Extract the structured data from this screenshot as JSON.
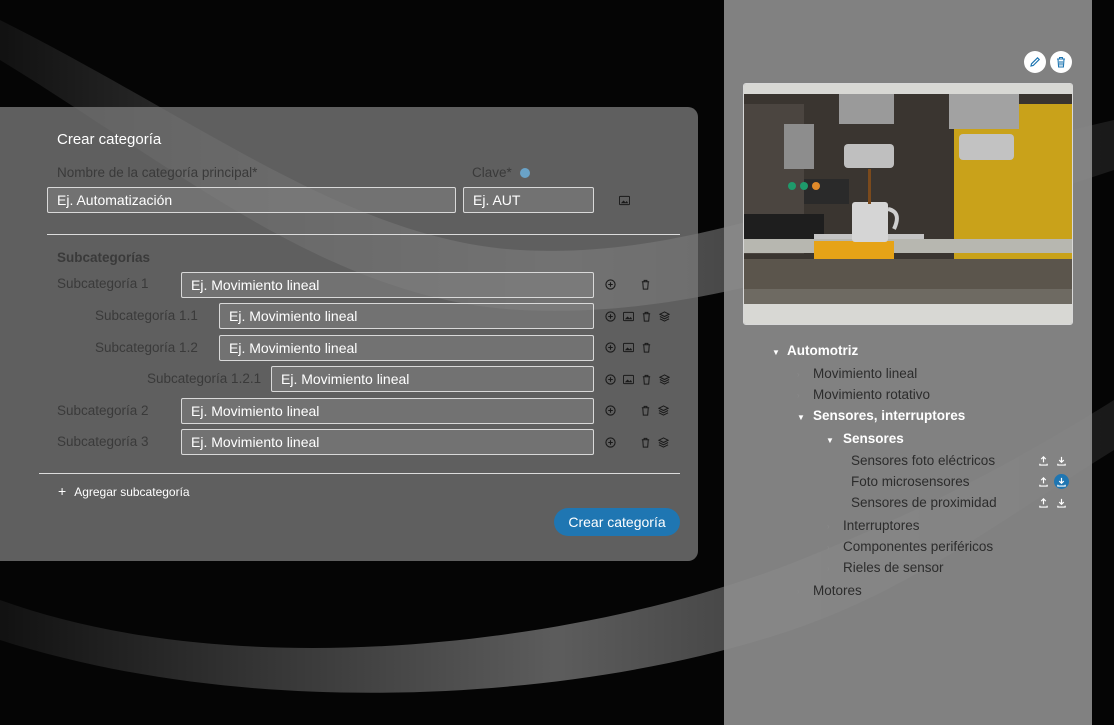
{
  "form": {
    "title": "Crear categoría",
    "main_name_label": "Nombre de la categoría principal*",
    "main_name_placeholder": "Ej. Automatización",
    "key_label": "Clave*",
    "key_placeholder": "Ej. AUT",
    "subcategories_heading": "Subcategorías",
    "subcategories": [
      {
        "label": "Subcategoría 1",
        "placeholder": "Ej. Movimiento lineal",
        "icons": [
          "add-circle-icon",
          "trash-icon"
        ]
      },
      {
        "label": "Subcategoría 1.1",
        "placeholder": "Ej. Movimiento lineal",
        "icons": [
          "add-circle-icon",
          "image-icon",
          "trash-icon",
          "layers-icon"
        ]
      },
      {
        "label": "Subcategoría 1.2",
        "placeholder": "Ej. Movimiento lineal",
        "icons": [
          "add-circle-icon",
          "image-icon",
          "trash-icon"
        ]
      },
      {
        "label": "Subcategoría 1.2.1",
        "placeholder": "Ej. Movimiento lineal",
        "icons": [
          "add-circle-icon",
          "image-icon",
          "trash-icon",
          "layers-icon"
        ]
      },
      {
        "label": "Subcategoría 2",
        "placeholder": "Ej. Movimiento lineal",
        "icons": [
          "add-circle-icon",
          "trash-icon",
          "layers-icon"
        ]
      },
      {
        "label": "Subcategoría 3",
        "placeholder": "Ej. Movimiento lineal",
        "icons": [
          "add-circle-icon",
          "trash-icon",
          "layers-icon"
        ]
      }
    ],
    "add_subcategory": "Agregar subcategoría",
    "submit": "Crear categoría"
  },
  "tree": {
    "items": [
      {
        "label": "Automotriz",
        "expanded": true,
        "highlighted": true
      },
      {
        "label": "Movimiento lineal",
        "expanded": false
      },
      {
        "label": "Movimiento rotativo",
        "expanded": false
      },
      {
        "label": "Sensores, interruptores",
        "expanded": true,
        "highlighted": true
      },
      {
        "label": "Sensores",
        "expanded": true,
        "highlighted": true
      },
      {
        "label": "Sensores foto eléctricos",
        "actions": [
          "upload-icon",
          "download-icon"
        ]
      },
      {
        "label": "Foto microsensores",
        "actions": [
          "upload-icon",
          "download-icon"
        ],
        "active_action": "download-icon"
      },
      {
        "label": "Sensores de proximidad",
        "actions": [
          "upload-icon",
          "download-icon"
        ]
      },
      {
        "label": "Interruptores",
        "expanded": false
      },
      {
        "label": "Componentes periféricos",
        "expanded": false
      },
      {
        "label": "Rieles de sensor",
        "expanded": false
      },
      {
        "label": "Motores",
        "expanded": false
      }
    ]
  },
  "panel_actions": [
    "edit-pencil-icon",
    "delete-trash-icon"
  ],
  "colors": {
    "accent": "#1f76b2",
    "card_bg": "#787878",
    "panel_bg": "#8c8c8c"
  }
}
